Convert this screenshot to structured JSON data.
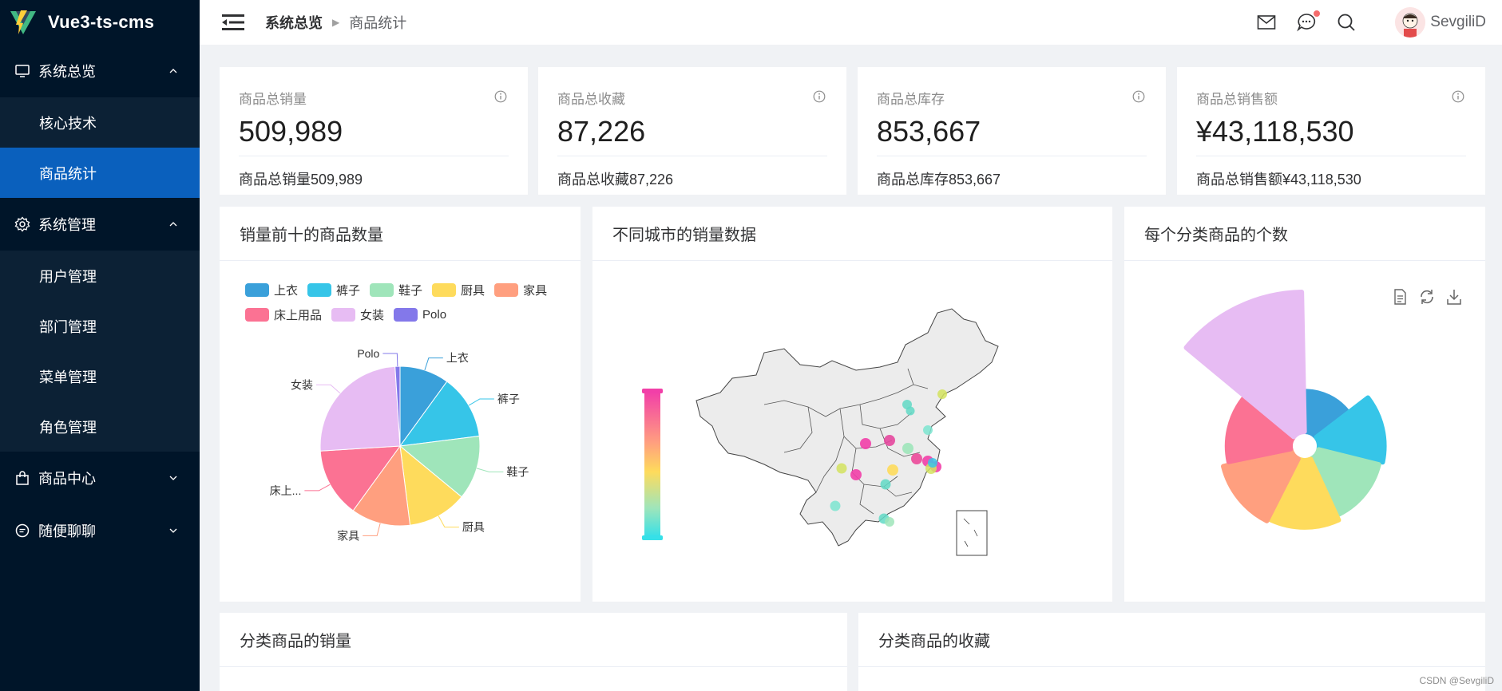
{
  "app": {
    "title": "Vue3-ts-cms"
  },
  "sidebar": {
    "groups": [
      {
        "label": "系统总览",
        "icon": "monitor-icon",
        "expanded": true,
        "items": [
          {
            "label": "核心技术",
            "active": false
          },
          {
            "label": "商品统计",
            "active": true
          }
        ]
      },
      {
        "label": "系统管理",
        "icon": "gear-icon",
        "expanded": true,
        "items": [
          {
            "label": "用户管理"
          },
          {
            "label": "部门管理"
          },
          {
            "label": "菜单管理"
          },
          {
            "label": "角色管理"
          }
        ]
      },
      {
        "label": "商品中心",
        "icon": "shopping-bag-icon",
        "expanded": false,
        "items": []
      },
      {
        "label": "随便聊聊",
        "icon": "chat-icon",
        "expanded": false,
        "items": []
      }
    ]
  },
  "header": {
    "breadcrumb": [
      "系统总览",
      "商品统计"
    ],
    "user": {
      "name": "SevgiliD"
    },
    "icons": [
      "mail-icon",
      "message-icon",
      "search-icon"
    ]
  },
  "stats": [
    {
      "title": "商品总销量",
      "value": "509,989",
      "foot": "商品总销量509,989"
    },
    {
      "title": "商品总收藏",
      "value": "87,226",
      "foot": "商品总收藏87,226"
    },
    {
      "title": "商品总库存",
      "value": "853,667",
      "foot": "商品总库存853,667"
    },
    {
      "title": "商品总销售额",
      "value": "¥43,118,530",
      "foot": "商品总销售额¥43,118,530"
    }
  ],
  "panels": {
    "top10": {
      "title": "销量前十的商品数量"
    },
    "city": {
      "title": "不同城市的销量数据"
    },
    "category_count": {
      "title": "每个分类商品的个数"
    },
    "category_sales": {
      "title": "分类商品的销量"
    },
    "category_fav": {
      "title": "分类商品的收藏"
    }
  },
  "watermark": "CSDN @SevgiliD",
  "colors": {
    "sidebar": "#001529",
    "submenu": "#0c2135",
    "active": "#0a60bd"
  },
  "chart_data": [
    {
      "type": "pie",
      "title": "销量前十的商品数量",
      "legend_position": "top",
      "categories": [
        "上衣",
        "裤子",
        "鞋子",
        "厨具",
        "家具",
        "床上用品",
        "女装",
        "Polo"
      ],
      "label_texts": [
        "上衣",
        "裤子",
        "鞋子",
        "厨具",
        "家具",
        "床上...",
        "女装",
        "Polo"
      ],
      "values": [
        10,
        13,
        13,
        12,
        12,
        14,
        25,
        1
      ],
      "colors": [
        "#3aa0da",
        "#36c5e8",
        "#9fe5ba",
        "#fedb5c",
        "#ff9f7f",
        "#fb7293",
        "#e7bcf3",
        "#8378ea"
      ]
    },
    {
      "type": "pie",
      "title": "每个分类商品的个数",
      "variant": "rose",
      "categories": [
        "上衣",
        "裤子",
        "鞋子",
        "厨具",
        "家具",
        "床上用品",
        "女装"
      ],
      "values": [
        64,
        103,
        98,
        106,
        110,
        100,
        221
      ],
      "colors": [
        "#3aa0da",
        "#36c5e8",
        "#9fe5ba",
        "#fedb5c",
        "#ff9f7f",
        "#fb7293",
        "#e7bcf3"
      ],
      "toolbox": [
        "data-view-icon",
        "restore-icon",
        "download-icon"
      ]
    }
  ]
}
